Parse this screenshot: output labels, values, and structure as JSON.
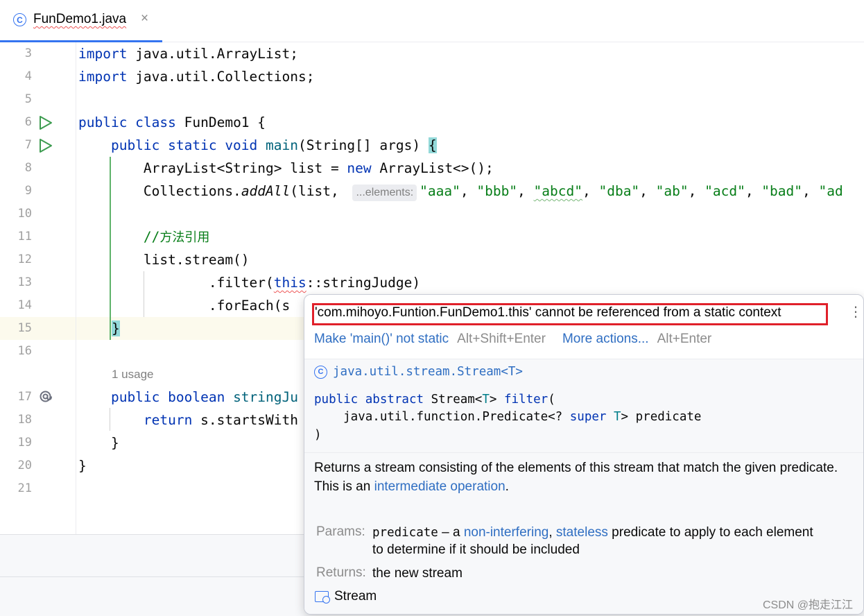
{
  "tab": {
    "icon": "class-c-icon",
    "filename": "FunDemo1.java",
    "close": "×"
  },
  "line_numbers": [
    "3",
    "4",
    "5",
    "6",
    "7",
    "8",
    "9",
    "10",
    "11",
    "12",
    "13",
    "14",
    "15",
    "16",
    "17",
    "18",
    "19",
    "20",
    "21"
  ],
  "code": {
    "l3a": "import",
    "l3b": " java.util.ArrayList;",
    "l4a": "import",
    "l4b": " java.util.Collections;",
    "l6a": "public class",
    "l6b": " FunDemo1 {",
    "l7a": "    public static void",
    "l7b": " main",
    "l7c": "(String[] args) ",
    "l7d": "{",
    "l8a": "        ArrayList<String> list = ",
    "l8b": "new",
    "l8c": " ArrayList<>();",
    "l9a": "        Collections.",
    "l9b": "addAll",
    "l9c": "(list, ",
    "l9_inlay": "...elements:",
    "l9_s1": "\"aaa\"",
    "l9_c1": ", ",
    "l9_s2": "\"bbb\"",
    "l9_c2": ", ",
    "l9_s3": "\"abcd\"",
    "l9_c3": ", ",
    "l9_s4": "\"dba\"",
    "l9_c4": ", ",
    "l9_s5": "\"ab\"",
    "l9_c5": ", ",
    "l9_s6": "\"acd\"",
    "l9_c6": ", ",
    "l9_s7": "\"bad\"",
    "l9_c7": ", ",
    "l9_s8": "\"ad",
    "l11a": "        //",
    "l11b": "方法引用",
    "l12": "        list.stream()",
    "l13a": "                .filter(",
    "l13b": "this",
    "l13c": "::stringJudge)",
    "l14": "                .forEach(s",
    "l15": "}",
    "usage": "1 usage",
    "l17a": "    public boolean",
    "l17b": " stringJu",
    "l18a": "        return",
    "l18b": " s.startsWith",
    "l19": "    }",
    "l20": "}"
  },
  "popup": {
    "error": "'com.mihoyo.Funtion.FunDemo1.this' cannot be referenced from a static context",
    "action1": "Make 'main()' not static",
    "shortcut1": "Alt+Shift+Enter",
    "action2": "More actions...",
    "shortcut2": "Alt+Enter",
    "class_name": "java.util.stream.Stream<T>",
    "sig1a": "public abstract",
    "sig1b": " Stream<",
    "sig1c": "T",
    "sig1d": "> ",
    "sig1e": "filter",
    "sig1f": "(",
    "sig2a": "    java.util.function.Predicate<? ",
    "sig2b": "super",
    "sig2c": " ",
    "sig2d": "T",
    "sig2e": "> predicate",
    "sig3": ")",
    "desc1": "Returns a stream consisting of the elements of this stream that match the given predicate.",
    "desc2a": "This is an ",
    "desc2b": "intermediate operation",
    "desc2c": ".",
    "params_label": "Params:",
    "param_name": "predicate",
    "param_t1": " – a ",
    "param_l1": "non-interfering",
    "param_t2": ", ",
    "param_l2": "stateless",
    "param_t3": " predicate to apply to each element to determine if it should be included",
    "returns_label": "Returns:",
    "returns_text": "the new stream",
    "stream_link": "Stream"
  },
  "watermark": "CSDN @抱走江江"
}
